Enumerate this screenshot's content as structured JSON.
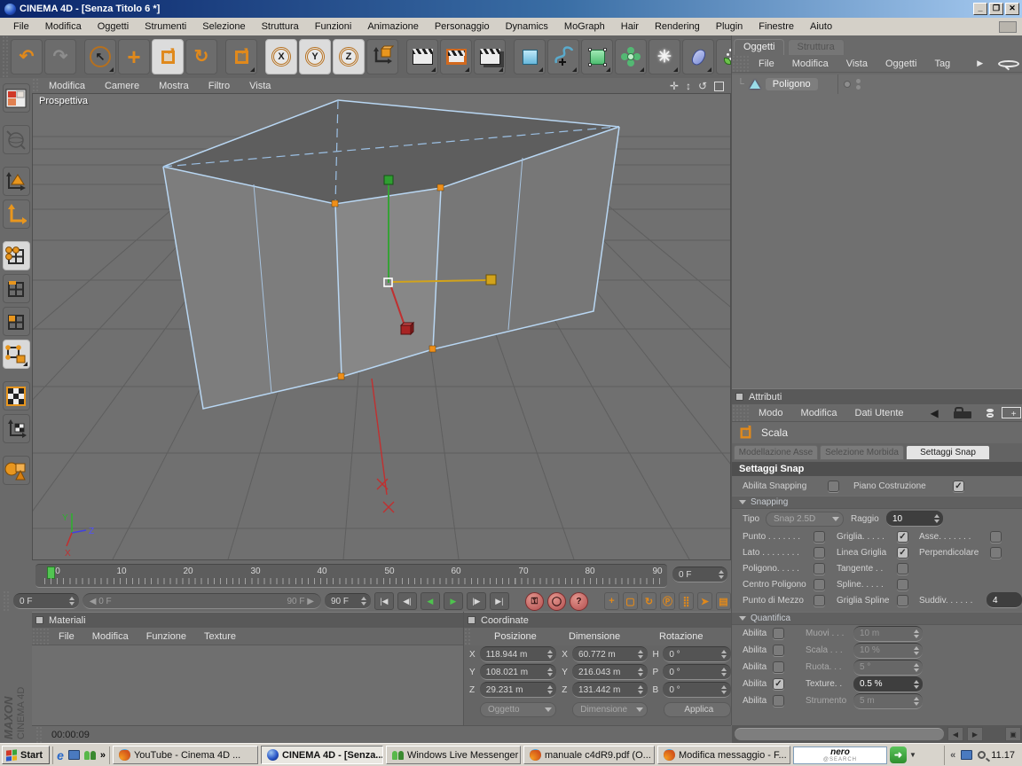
{
  "window": {
    "title": "CINEMA 4D - [Senza Titolo 6 *]"
  },
  "menubar": {
    "items": [
      "File",
      "Modifica",
      "Oggetti",
      "Strumenti",
      "Selezione",
      "Struttura",
      "Funzioni",
      "Animazione",
      "Personaggio",
      "Dynamics",
      "MoGraph",
      "Hair",
      "Rendering",
      "Plugin",
      "Finestre",
      "Aiuto"
    ]
  },
  "toolbar": {
    "x": "X",
    "y": "Y",
    "z": "Z",
    "help": "?"
  },
  "viewport": {
    "label": "Prospettiva",
    "menu": [
      "Modifica",
      "Camere",
      "Mostra",
      "Filtro",
      "Vista"
    ],
    "axis": {
      "x": "X",
      "y": "Y",
      "z": "Z"
    }
  },
  "timeline": {
    "ticks": [
      "0",
      "10",
      "20",
      "30",
      "40",
      "50",
      "60",
      "70",
      "80",
      "90"
    ],
    "current": "0 F",
    "start": "0 F",
    "slider_start": "0 F",
    "slider_end": "90 F",
    "end": "90 F"
  },
  "materials": {
    "title": "Materiali",
    "menu": [
      "File",
      "Modifica",
      "Funzione",
      "Texture"
    ]
  },
  "coord": {
    "title": "Coordinate",
    "headers": [
      "Posizione",
      "Dimensione",
      "Rotazione"
    ],
    "rows": [
      {
        "pl": "X",
        "pv": "118.944 m",
        "dl": "X",
        "dv": "60.772 m",
        "rl": "H",
        "rv": "0 °"
      },
      {
        "pl": "Y",
        "pv": "108.021 m",
        "dl": "Y",
        "dv": "216.043 m",
        "rl": "P",
        "rv": "0 °"
      },
      {
        "pl": "Z",
        "pv": "29.231 m",
        "dl": "Z",
        "dv": "131.442 m",
        "rl": "B",
        "rv": "0 °"
      }
    ],
    "mode1": "Oggetto",
    "mode2": "Dimensione",
    "apply": "Applica"
  },
  "om": {
    "tabs": [
      "Oggetti",
      "Struttura"
    ],
    "menu": [
      "File",
      "Modifica",
      "Vista",
      "Oggetti",
      "Tag"
    ],
    "object": "Poligono"
  },
  "attr": {
    "title": "Attributi",
    "menu": [
      "Modo",
      "Modifica",
      "Dati Utente"
    ],
    "tool": "Scala",
    "tabs": [
      "Modellazione Asse",
      "Selezione Morbida",
      "Settaggi Snap"
    ],
    "section": "Settaggi Snap",
    "row1": {
      "l1": "Abilita Snapping",
      "c1": "",
      "l2": "Piano Costruzione",
      "c2": "✓"
    },
    "snapping": {
      "group": "Snapping",
      "tipo_label": "Tipo",
      "tipo_value": "Snap 2.5D",
      "raggio_label": "Raggio",
      "raggio_value": "10",
      "rows": [
        {
          "l1": "Punto . . . . . . .",
          "c1": "",
          "l2": "Griglia. . . . .",
          "c2": "✓",
          "l3": "Asse. . . . . . .",
          "c3": ""
        },
        {
          "l1": "Lato . . . . . . . .",
          "c1": "",
          "l2": "Linea Griglia",
          "c2": "✓",
          "l3": "Perpendicolare",
          "c3": ""
        },
        {
          "l1": "Poligono. . . . .",
          "c1": "",
          "l2": "Tangente . .",
          "c2": ""
        },
        {
          "l1": "Centro Poligono",
          "c1": "",
          "l2": "Spline. . . . .",
          "c2": ""
        },
        {
          "l1": "Punto di Mezzo",
          "c1": "",
          "l2": "Griglia Spline",
          "c2": "",
          "l3": "Suddiv. . . . . .",
          "v3": "4"
        }
      ]
    },
    "quantify": {
      "group": "Quantifica",
      "rows": [
        {
          "en": "Abilita",
          "c": "",
          "label": "Muovi . . .",
          "value": "10 m"
        },
        {
          "en": "Abilita",
          "c": "",
          "label": "Scala . . .",
          "value": "10 %"
        },
        {
          "en": "Abilita",
          "c": "",
          "label": "Ruota. . .",
          "value": "5 °"
        },
        {
          "en": "Abilita",
          "c": "✓",
          "label": "Texture. .",
          "value": "0.5 %"
        },
        {
          "en": "Abilita",
          "c": "",
          "label": "Strumento",
          "value": "5 m"
        }
      ]
    }
  },
  "status": {
    "render_time": "00:00:09"
  },
  "branding": {
    "maxon": "MAXON",
    "product": "CINEMA 4D"
  },
  "taskbar": {
    "start": "Start",
    "tasks": [
      {
        "title": "YouTube - Cinema 4D ..."
      },
      {
        "title": "CINEMA 4D - [Senza..."
      },
      {
        "title": "Windows Live Messenger"
      },
      {
        "title": "manuale c4dR9.pdf (O..."
      },
      {
        "title": "Modifica messaggio - F..."
      }
    ],
    "nero": {
      "line1": "nero",
      "line2": "@SEARCH"
    },
    "tray_time": "11.17"
  }
}
